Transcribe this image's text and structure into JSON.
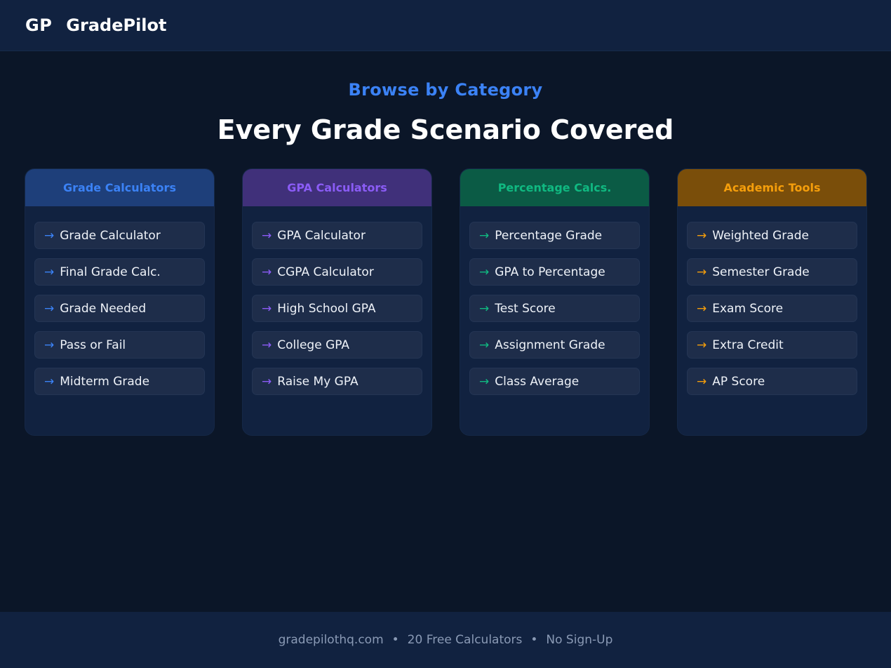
{
  "header": {
    "logo_mark": "GP",
    "brand": "GradePilot"
  },
  "hero": {
    "eyebrow": "Browse by Category",
    "title": "Every Grade Scenario Covered"
  },
  "categories": [
    {
      "title": "Grade Calculators",
      "accent": "#3b82f6",
      "head_bg": "#1e3f7a",
      "items": [
        "Grade Calculator",
        "Final Grade Calc.",
        "Grade Needed",
        "Pass or Fail",
        "Midterm Grade"
      ]
    },
    {
      "title": "GPA Calculators",
      "accent": "#8b5cf6",
      "head_bg": "#40307a",
      "items": [
        "GPA Calculator",
        "CGPA Calculator",
        "High School GPA",
        "College GPA",
        "Raise My GPA"
      ]
    },
    {
      "title": "Percentage Calcs.",
      "accent": "#10b981",
      "head_bg": "#0b5b45",
      "items": [
        "Percentage Grade",
        "GPA to Percentage",
        "Test Score",
        "Assignment Grade",
        "Class Average"
      ]
    },
    {
      "title": "Academic Tools",
      "accent": "#f59e0b",
      "head_bg": "#7a4e0a",
      "items": [
        "Weighted Grade",
        "Semester Grade",
        "Exam Score",
        "Extra Credit",
        "AP Score"
      ]
    }
  ],
  "arrow_glyph": "→",
  "footer": {
    "site": "gradepilothq.com",
    "separator": "•",
    "calculators": "20 Free Calculators",
    "signup": "No Sign-Up"
  }
}
